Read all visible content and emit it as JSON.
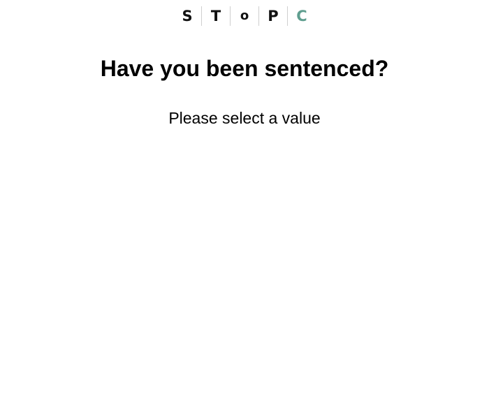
{
  "logo": {
    "letters": [
      "S",
      "T",
      "O",
      "P",
      "C"
    ],
    "accent_color": "#5f9e8f"
  },
  "question": {
    "title": "Have you been sentenced?",
    "prompt": "Please select a value"
  }
}
